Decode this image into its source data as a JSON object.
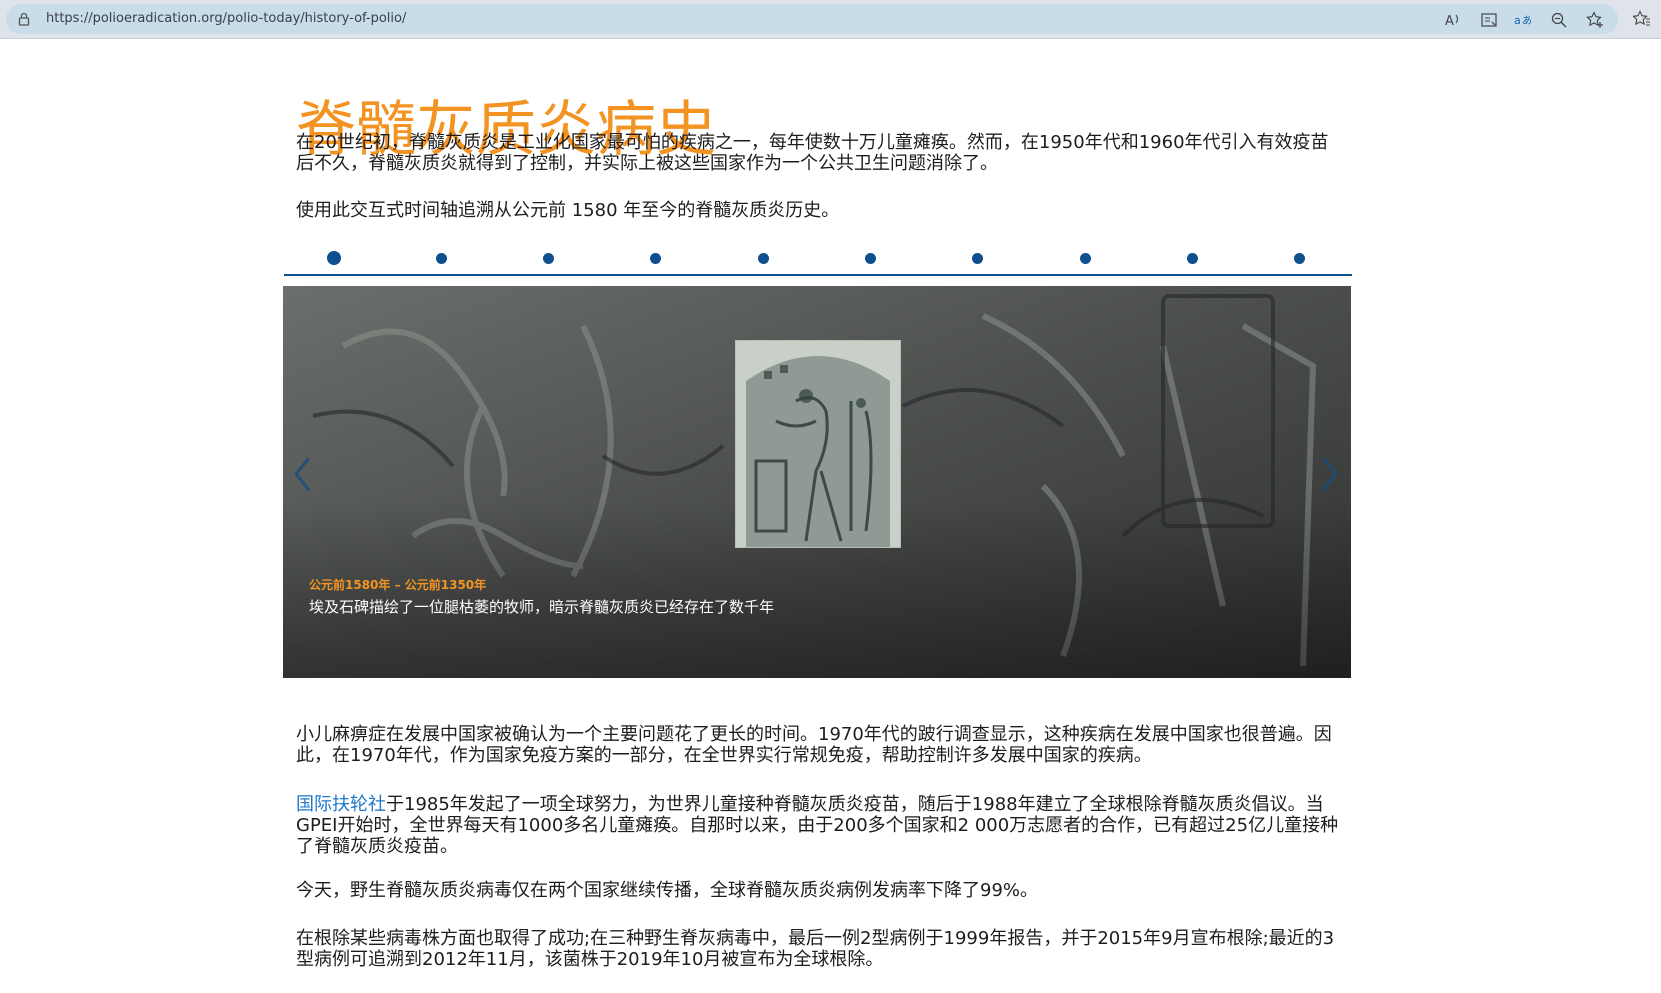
{
  "browser": {
    "url": "https://polioeradication.org/polio-today/history-of-polio/",
    "icons": [
      "lock-icon",
      "read-aloud-icon",
      "immersive-reader-icon",
      "translate-icon",
      "zoom-icon",
      "add-favorite-icon",
      "favorites-icon"
    ]
  },
  "page": {
    "title": "脊髓灰质炎病史",
    "intro": "在20世纪初，脊髓灰质炎是工业化国家最可怕的疾病之一，每年使数十万儿童瘫痪。然而，在1950年代和1960年代引入有效疫苗后不久，脊髓灰质炎就得到了控制，并实际上被这些国家作为一个公共卫生问题消除了。",
    "timeline_hint": "使用此交互式时间轴追溯从公元前 1580 年至今的脊髓灰质炎历史。",
    "timeline": {
      "dot_count": 10,
      "active_index": 0,
      "accent": "#0e4f8e"
    },
    "slide": {
      "date": "公元前1580年 – 公元前1350年",
      "caption": "埃及石碑描绘了一位腿枯萎的牧师，暗示脊髓灰质炎已经存在了数千年",
      "prev_icon": "chevron-left-icon",
      "next_icon": "chevron-right-icon"
    },
    "para1": "小儿麻痹症在发展中国家被确认为一个主要问题花了更长的时间。1970年代的跛行调查显示，这种疾病在发展中国家也很普遍。因此，在1970年代，作为国家免疫方案的一部分，在全世界实行常规免疫，帮助控制许多发展中国家的疾病。",
    "para2_link": "国际扶轮社",
    "para2_rest": "于1985年发起了一项全球努力，为世界儿童接种脊髓灰质炎疫苗，随后于1988年建立了全球根除脊髓灰质炎倡议。当GPEI开始时，全世界每天有1000多名儿童瘫痪。自那时以来，由于200多个国家和2 000万志愿者的合作，已有超过25亿儿童接种了脊髓灰质炎疫苗。",
    "para3": "今天，野生脊髓灰质炎病毒仅在两个国家继续传播，全球脊髓灰质炎病例发病率下降了99%。",
    "para4": "在根除某些病毒株方面也取得了成功;在三种野生脊灰病毒中，最后一例2型病例于1999年报告，并于2015年9月宣布根除;最近的3型病例可追溯到2012年11月，该菌株于2019年10月被宣布为全球根除。"
  },
  "colors": {
    "title": "#f39322",
    "link": "#1f78c8",
    "timeline": "#0e4f8e"
  }
}
